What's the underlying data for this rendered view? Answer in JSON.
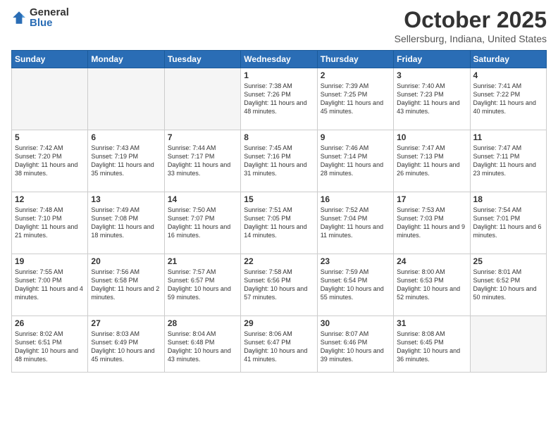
{
  "logo": {
    "general": "General",
    "blue": "Blue"
  },
  "title": {
    "month": "October 2025",
    "location": "Sellersburg, Indiana, United States"
  },
  "headers": [
    "Sunday",
    "Monday",
    "Tuesday",
    "Wednesday",
    "Thursday",
    "Friday",
    "Saturday"
  ],
  "weeks": [
    [
      {
        "day": "",
        "info": ""
      },
      {
        "day": "",
        "info": ""
      },
      {
        "day": "",
        "info": ""
      },
      {
        "day": "1",
        "info": "Sunrise: 7:38 AM\nSunset: 7:26 PM\nDaylight: 11 hours and 48 minutes."
      },
      {
        "day": "2",
        "info": "Sunrise: 7:39 AM\nSunset: 7:25 PM\nDaylight: 11 hours and 45 minutes."
      },
      {
        "day": "3",
        "info": "Sunrise: 7:40 AM\nSunset: 7:23 PM\nDaylight: 11 hours and 43 minutes."
      },
      {
        "day": "4",
        "info": "Sunrise: 7:41 AM\nSunset: 7:22 PM\nDaylight: 11 hours and 40 minutes."
      }
    ],
    [
      {
        "day": "5",
        "info": "Sunrise: 7:42 AM\nSunset: 7:20 PM\nDaylight: 11 hours and 38 minutes."
      },
      {
        "day": "6",
        "info": "Sunrise: 7:43 AM\nSunset: 7:19 PM\nDaylight: 11 hours and 35 minutes."
      },
      {
        "day": "7",
        "info": "Sunrise: 7:44 AM\nSunset: 7:17 PM\nDaylight: 11 hours and 33 minutes."
      },
      {
        "day": "8",
        "info": "Sunrise: 7:45 AM\nSunset: 7:16 PM\nDaylight: 11 hours and 31 minutes."
      },
      {
        "day": "9",
        "info": "Sunrise: 7:46 AM\nSunset: 7:14 PM\nDaylight: 11 hours and 28 minutes."
      },
      {
        "day": "10",
        "info": "Sunrise: 7:47 AM\nSunset: 7:13 PM\nDaylight: 11 hours and 26 minutes."
      },
      {
        "day": "11",
        "info": "Sunrise: 7:47 AM\nSunset: 7:11 PM\nDaylight: 11 hours and 23 minutes."
      }
    ],
    [
      {
        "day": "12",
        "info": "Sunrise: 7:48 AM\nSunset: 7:10 PM\nDaylight: 11 hours and 21 minutes."
      },
      {
        "day": "13",
        "info": "Sunrise: 7:49 AM\nSunset: 7:08 PM\nDaylight: 11 hours and 18 minutes."
      },
      {
        "day": "14",
        "info": "Sunrise: 7:50 AM\nSunset: 7:07 PM\nDaylight: 11 hours and 16 minutes."
      },
      {
        "day": "15",
        "info": "Sunrise: 7:51 AM\nSunset: 7:05 PM\nDaylight: 11 hours and 14 minutes."
      },
      {
        "day": "16",
        "info": "Sunrise: 7:52 AM\nSunset: 7:04 PM\nDaylight: 11 hours and 11 minutes."
      },
      {
        "day": "17",
        "info": "Sunrise: 7:53 AM\nSunset: 7:03 PM\nDaylight: 11 hours and 9 minutes."
      },
      {
        "day": "18",
        "info": "Sunrise: 7:54 AM\nSunset: 7:01 PM\nDaylight: 11 hours and 6 minutes."
      }
    ],
    [
      {
        "day": "19",
        "info": "Sunrise: 7:55 AM\nSunset: 7:00 PM\nDaylight: 11 hours and 4 minutes."
      },
      {
        "day": "20",
        "info": "Sunrise: 7:56 AM\nSunset: 6:58 PM\nDaylight: 11 hours and 2 minutes."
      },
      {
        "day": "21",
        "info": "Sunrise: 7:57 AM\nSunset: 6:57 PM\nDaylight: 10 hours and 59 minutes."
      },
      {
        "day": "22",
        "info": "Sunrise: 7:58 AM\nSunset: 6:56 PM\nDaylight: 10 hours and 57 minutes."
      },
      {
        "day": "23",
        "info": "Sunrise: 7:59 AM\nSunset: 6:54 PM\nDaylight: 10 hours and 55 minutes."
      },
      {
        "day": "24",
        "info": "Sunrise: 8:00 AM\nSunset: 6:53 PM\nDaylight: 10 hours and 52 minutes."
      },
      {
        "day": "25",
        "info": "Sunrise: 8:01 AM\nSunset: 6:52 PM\nDaylight: 10 hours and 50 minutes."
      }
    ],
    [
      {
        "day": "26",
        "info": "Sunrise: 8:02 AM\nSunset: 6:51 PM\nDaylight: 10 hours and 48 minutes."
      },
      {
        "day": "27",
        "info": "Sunrise: 8:03 AM\nSunset: 6:49 PM\nDaylight: 10 hours and 45 minutes."
      },
      {
        "day": "28",
        "info": "Sunrise: 8:04 AM\nSunset: 6:48 PM\nDaylight: 10 hours and 43 minutes."
      },
      {
        "day": "29",
        "info": "Sunrise: 8:06 AM\nSunset: 6:47 PM\nDaylight: 10 hours and 41 minutes."
      },
      {
        "day": "30",
        "info": "Sunrise: 8:07 AM\nSunset: 6:46 PM\nDaylight: 10 hours and 39 minutes."
      },
      {
        "day": "31",
        "info": "Sunrise: 8:08 AM\nSunset: 6:45 PM\nDaylight: 10 hours and 36 minutes."
      },
      {
        "day": "",
        "info": ""
      }
    ]
  ]
}
